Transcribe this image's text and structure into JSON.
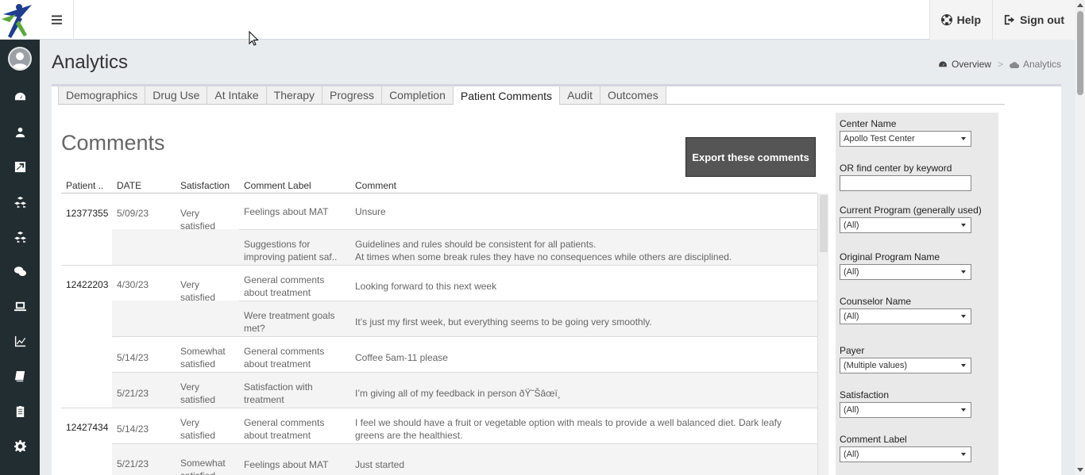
{
  "header": {
    "help_label": "Help",
    "signout_label": "Sign out"
  },
  "page": {
    "title": "Analytics",
    "breadcrumb": {
      "overview": "Overview",
      "separator": ">",
      "current": "Analytics"
    }
  },
  "tabs": [
    {
      "label": "Demographics"
    },
    {
      "label": "Drug Use"
    },
    {
      "label": "At Intake"
    },
    {
      "label": "Therapy"
    },
    {
      "label": "Progress"
    },
    {
      "label": "Completion"
    },
    {
      "label": "Patient Comments"
    },
    {
      "label": "Audit"
    },
    {
      "label": "Outcomes"
    }
  ],
  "comments": {
    "title": "Comments",
    "export_label": "Export these comments",
    "columns": {
      "patient": "Patient ..",
      "date": "DATE",
      "satisfaction": "Satisfaction",
      "label": "Comment Label",
      "comment": "Comment"
    },
    "patients": [
      {
        "id": "12377355"
      },
      {
        "id": "12422203"
      },
      {
        "id": "12427434"
      }
    ],
    "rows": [
      {
        "date": "5/09/23",
        "sat1": "Very",
        "sat2": "satisfied",
        "label1": "Feelings about MAT",
        "label2": "",
        "comment1": "Unsure",
        "comment2": ""
      },
      {
        "date": "",
        "sat1": "",
        "sat2": "",
        "label1": "Suggestions for",
        "label2": "improving patient saf..",
        "comment1": "Guidelines and rules should be consistent for all patients.",
        "comment2": "At times when some break rules they have no consequences while others are disciplined."
      },
      {
        "date": "4/30/23",
        "sat1": "Very",
        "sat2": "satisfied",
        "label1": "General comments",
        "label2": "about treatment",
        "comment1": "Looking forward to this next week",
        "comment2": ""
      },
      {
        "date": "",
        "sat1": "",
        "sat2": "",
        "label1": "Were treatment goals",
        "label2": "met?",
        "comment1": "It’s just my first week, but everything seems to be going very smoothly.",
        "comment2": ""
      },
      {
        "date": "5/14/23",
        "sat1": "Somewhat",
        "sat2": "satisfied",
        "label1": "General comments",
        "label2": "about treatment",
        "comment1": "Coffee 5am-11 please",
        "comment2": ""
      },
      {
        "date": "5/21/23",
        "sat1": "Very",
        "sat2": "satisfied",
        "label1": "Satisfaction with",
        "label2": "treatment",
        "comment1": "I’m giving all of my feedback in person ðŸ˜Šâœï¸",
        "comment2": ""
      },
      {
        "date": "5/14/23",
        "sat1": "Very",
        "sat2": "satisfied",
        "label1": "General comments",
        "label2": "about treatment",
        "comment1": "I feel we should have a fruit or vegetable option with meals to provide a well balanced diet. Dark leafy",
        "comment2": "greens are the healthiest."
      },
      {
        "date": "5/21/23",
        "sat1": "Somewhat",
        "sat2": "satisfied",
        "label1": "Feelings about MAT",
        "label2": "",
        "comment1": "Just started",
        "comment2": ""
      }
    ]
  },
  "filters": {
    "center_name": {
      "label": "Center Name",
      "value": "Apollo Test Center"
    },
    "center_keyword": {
      "label": "OR find center by keyword",
      "value": ""
    },
    "current_program": {
      "label": "Current Program (generally used)",
      "value": "(All)"
    },
    "original_program": {
      "label": "Original Program Name",
      "value": "(All)"
    },
    "counselor": {
      "label": "Counselor Name",
      "value": "(All)"
    },
    "payer": {
      "label": "Payer",
      "value": "(Multiple values)"
    },
    "satisfaction": {
      "label": "Satisfaction",
      "value": "(All)"
    },
    "comment_label": {
      "label": "Comment Label",
      "value": "(All)"
    }
  },
  "icons": {
    "sidebar": [
      "dashboard-icon",
      "user-icon",
      "external-icon",
      "cubes-icon",
      "cubes-icon",
      "chat-icon",
      "laptop-icon",
      "line-chart-icon",
      "book-icon",
      "clipboard-icon",
      "gear-icon"
    ]
  },
  "colors": {
    "sidebar": "#222d32",
    "export_button": "#555555",
    "logo_blue": "#1f3d8f",
    "logo_green": "#5aa83a"
  }
}
